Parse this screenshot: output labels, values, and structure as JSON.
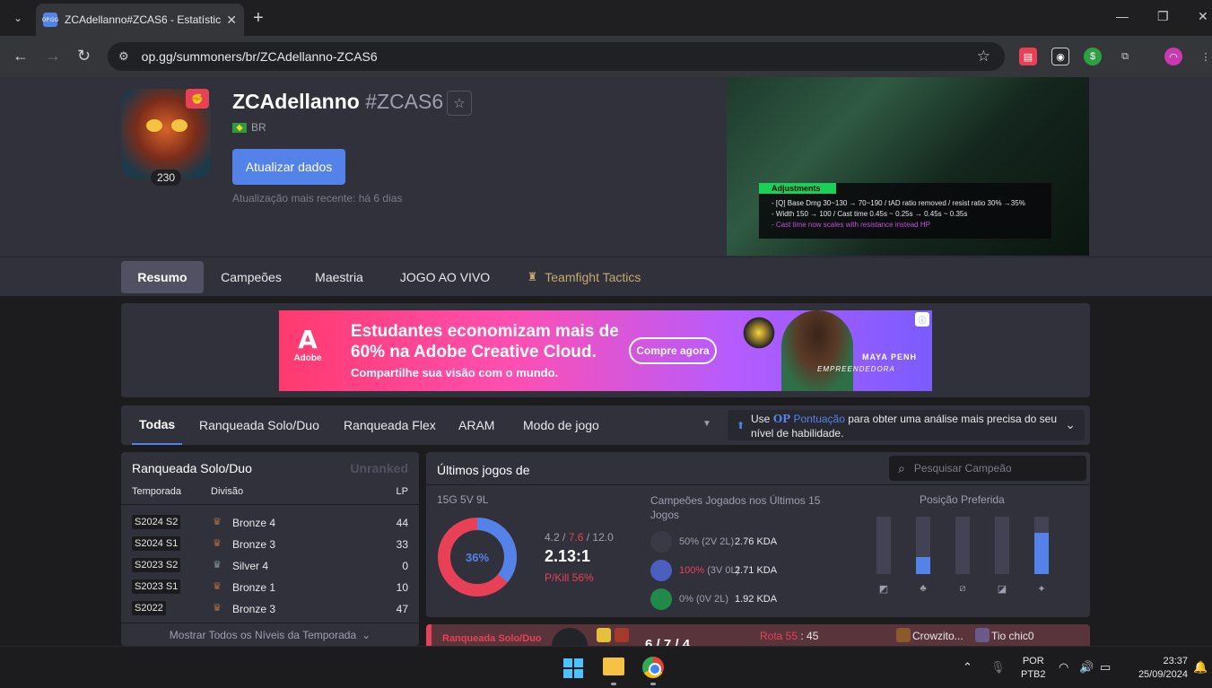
{
  "browser": {
    "tab_title": "ZCAdellanno#ZCAS6 - Estatístic",
    "favicon_text": "OP.GG",
    "url": "op.gg/summoners/br/ZCAdellanno-ZCAS6"
  },
  "profile": {
    "name": "ZCAdellanno",
    "tag": "#ZCAS6",
    "region": "BR",
    "level": "230",
    "update_button": "Atualizar dados",
    "last_updated": "Atualização mais recente: há 6 dias"
  },
  "stream": {
    "heading": "Adjustments",
    "lines": [
      "- [Q] Base Dmg 30~130 → 70~190 / tAD ratio removed / resist ratio 30% →35%",
      "- Width 150 → 100 / Cast time 0.45s ~ 0.25s → 0.45s ~ 0.35s",
      "- Cast time now scales with resistance instead HP"
    ]
  },
  "profile_tabs": [
    "Resumo",
    "Campeões",
    "Maestria",
    "JOGO AO VIVO",
    "Teamfight Tactics"
  ],
  "ad": {
    "brand": "Adobe",
    "headline": "Estudantes economizam mais de 60% na Adobe Creative Cloud.",
    "subline": "Compartilhe sua visão com o mundo.",
    "cta": "Compre agora",
    "person_name": "MAYA PENH",
    "person_sub": "EMPREENDEDORA"
  },
  "filters": {
    "tabs": [
      "Todas",
      "Ranqueada Solo/Duo",
      "Ranqueada Flex",
      "ARAM",
      "Modo de jogo"
    ],
    "op_use": "Use ",
    "op_brand": "OP",
    "op_score": " Pontuação",
    "op_text": " para obter uma análise mais precisa do seu nível de habilidade."
  },
  "ranked": {
    "title": "Ranqueada Solo/Duo",
    "status": "Unranked",
    "col_season": "Temporada",
    "col_division": "Divisão",
    "col_lp": "LP",
    "rows": [
      {
        "season": "S2024 S2",
        "tier": "Bronze 4",
        "lp": "44",
        "color": "#b4703e"
      },
      {
        "season": "S2024 S1",
        "tier": "Bronze 3",
        "lp": "33",
        "color": "#b4703e"
      },
      {
        "season": "S2023 S2",
        "tier": "Silver 4",
        "lp": "0",
        "color": "#80989d"
      },
      {
        "season": "S2023 S1",
        "tier": "Bronze 1",
        "lp": "10",
        "color": "#b4703e"
      },
      {
        "season": "S2022",
        "tier": "Bronze 3",
        "lp": "47",
        "color": "#b4703e"
      }
    ],
    "footer": "Mostrar Todos os Níveis da Temporada"
  },
  "recent": {
    "title": "Últimos jogos de",
    "search_placeholder": "Pesquisar Campeão",
    "record": "15G 5V 9L",
    "winrate_label": "36%",
    "winrate": 0.36,
    "kda_k": "4.2",
    "kda_d": "7.6",
    "kda_a": "12.0",
    "kda_ratio": "2.13:1",
    "pkill": "P/Kill 56%",
    "champs_title": "Campeões Jogados nos Últimos 15 Jogos",
    "champs": [
      {
        "wr": "50%",
        "wl": "(2V 2L)",
        "kda": "2.76 KDA",
        "hi": false,
        "color": "#3a3a46"
      },
      {
        "wr": "100%",
        "wl": "(3V 0L)",
        "kda": "2.71 KDA",
        "hi": true,
        "color": "#4b5fc0"
      },
      {
        "wr": "0%",
        "wl": "(0V 2L)",
        "kda": "1.92 KDA",
        "hi": false,
        "color": "#1f8a4a"
      }
    ],
    "positions_title": "Posição Preferida",
    "positions": [
      0,
      0.3,
      0,
      0,
      0.72
    ]
  },
  "game": {
    "queue": "Ranqueada Solo/Duo",
    "kda": "6 / 7 / 4",
    "rota": "Rota 55",
    "rota_time": " : 45",
    "player1": "Crowzito...",
    "player2": "Tio chic0"
  },
  "taskbar": {
    "lang1": "POR",
    "lang2": "PTB2",
    "time": "23:37",
    "date": "25/09/2024"
  }
}
